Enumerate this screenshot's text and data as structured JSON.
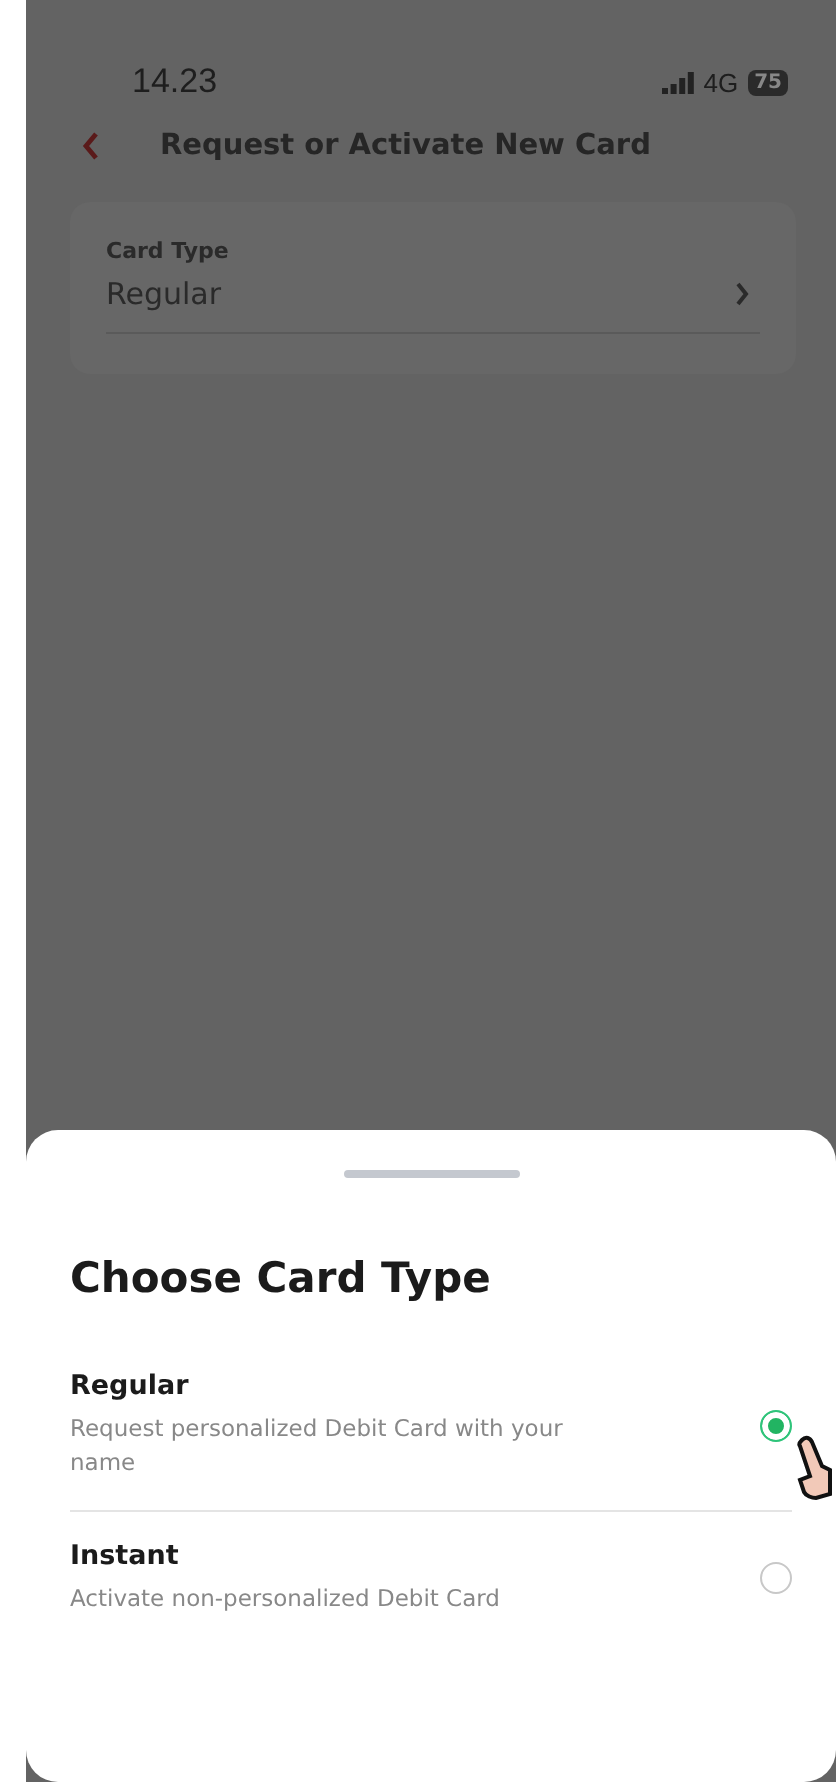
{
  "status_bar": {
    "time": "14.23",
    "network": "4G",
    "battery": "75"
  },
  "header": {
    "title": "Request or Activate New Card"
  },
  "field": {
    "label": "Card Type",
    "value": "Regular"
  },
  "sheet": {
    "title": "Choose Card Type",
    "options": [
      {
        "title": "Regular",
        "description": "Request personalized Debit Card with your name",
        "selected": true
      },
      {
        "title": "Instant",
        "description": "Activate non-personalized Debit Card",
        "selected": false
      }
    ]
  }
}
